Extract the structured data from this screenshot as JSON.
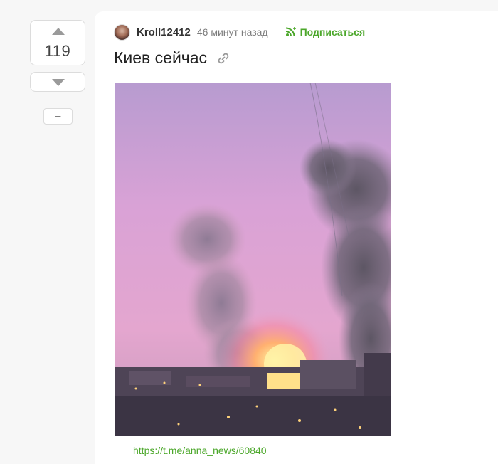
{
  "vote": {
    "count": "119",
    "collapse_label": "–"
  },
  "post": {
    "author": "Kroll12412",
    "time": "46 минут назад",
    "subscribe_label": "Подписаться",
    "title": "Киев сейчас",
    "source_link": "https://t.me/anna_news/60840"
  },
  "colors": {
    "accent_green": "#4ba72a",
    "text_dark": "#222222",
    "muted": "#7c7c7c"
  },
  "icons": {
    "upvote": "arrow-up-icon",
    "downvote": "arrow-down-icon",
    "subscribe": "subscribe-icon",
    "permalink": "link-icon"
  }
}
